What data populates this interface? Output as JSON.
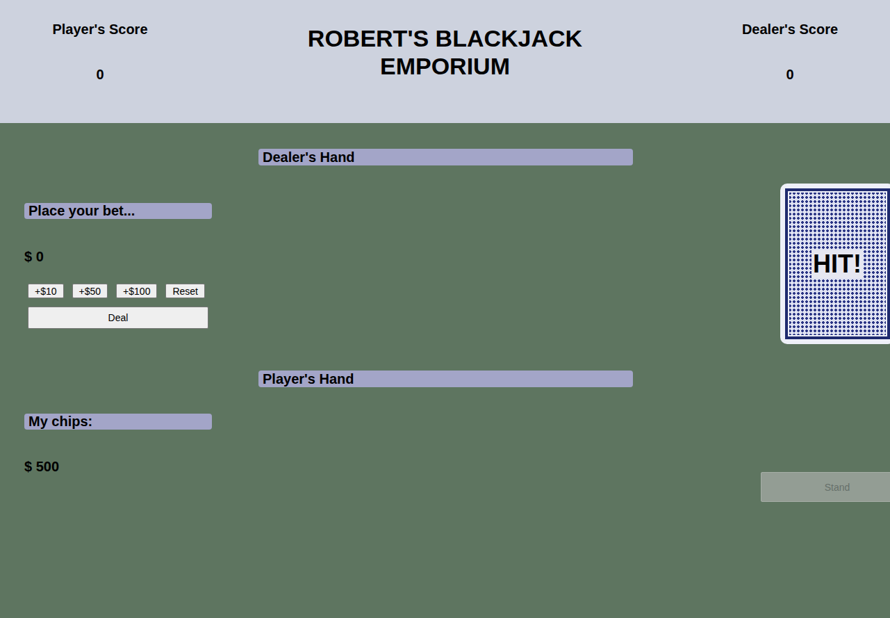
{
  "header": {
    "title": "ROBERT'S BLACKJACK EMPORIUM",
    "player_score": {
      "label": "Player's Score",
      "value": "0"
    },
    "dealer_score": {
      "label": "Dealer's Score",
      "value": "0"
    }
  },
  "bet": {
    "label": "Place your bet...",
    "amount": "$ 0",
    "buttons": [
      "+$10",
      "+$50",
      "+$100",
      "Reset"
    ],
    "deal": "Deal"
  },
  "chips": {
    "label": "My chips:",
    "amount": "$ 500"
  },
  "dealer_hand": {
    "label": "Dealer's Hand"
  },
  "player_hand": {
    "label": "Player's Hand"
  },
  "hit": {
    "label": "HIT!"
  },
  "stand": {
    "label": "Stand",
    "disabled": true
  }
}
